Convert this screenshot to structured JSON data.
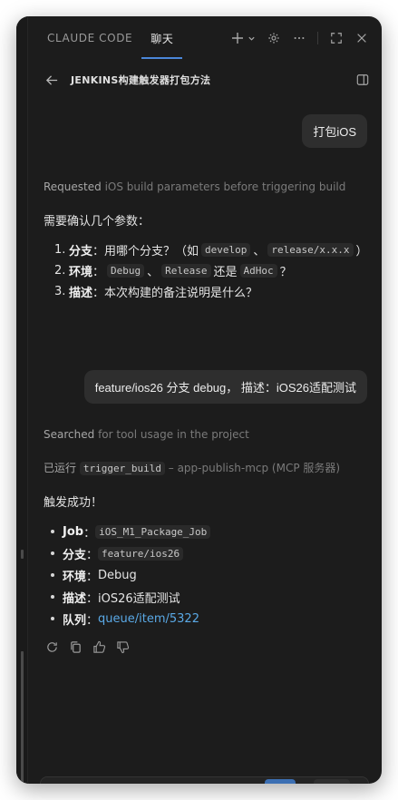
{
  "tabs": [
    {
      "label": "CLAUDE CODE",
      "active": false
    },
    {
      "label": "聊天",
      "active": true
    }
  ],
  "header": {
    "title": "JENKINS构建触发器打包方法"
  },
  "messages": {
    "user1": "打包iOS",
    "meta1": {
      "verb": "Requested",
      "detail": "iOS build parameters before triggering build"
    },
    "intro": "需要确认几个参数：",
    "questions": [
      {
        "num": "1.",
        "label": "分支",
        "colon": "：",
        "text1": "用哪个分支？（如",
        "code1": "develop",
        "sep": "、",
        "code2": "release/x.x.x",
        "text2": "）"
      },
      {
        "num": "2.",
        "label": "环境",
        "colon": "：",
        "code1": "Debug",
        "sep": "、",
        "code2": "Release",
        "text1": "还是",
        "code3": "AdHoc",
        "text2": "？"
      },
      {
        "num": "3.",
        "label": "描述",
        "colon": "：",
        "text1": "本次构建的备注说明是什么？"
      }
    ],
    "user2": "feature/ios26 分支 debug， 描述：iOS26适配测试",
    "meta2": {
      "verb": "Searched",
      "detail": "for tool usage in the project"
    },
    "meta3": {
      "prefix": "已运行",
      "code": "trigger_build",
      "suffix": "– app-publish-mcp (MCP 服务器)"
    },
    "success": "触发成功！",
    "results": [
      {
        "label": "Job",
        "colon": "：",
        "code": "iOS_M1_Package_Job"
      },
      {
        "label": "分支",
        "colon": "：",
        "code": "feature/ios26"
      },
      {
        "label": "环境",
        "colon": "：",
        "text": "Debug"
      },
      {
        "label": "描述",
        "colon": "：",
        "text": "iOS26适配测试"
      },
      {
        "label": "队列",
        "colon": "：",
        "link": "queue/item/5322"
      }
    ]
  },
  "icons": [
    "plus-icon",
    "chevron-down-icon",
    "gear-icon",
    "more-icon",
    "expand-icon",
    "close-icon",
    "arrow-left-icon",
    "panel-icon",
    "retry-icon",
    "copy-icon",
    "thumbs-up-icon",
    "thumbs-down-icon"
  ],
  "colors": {
    "accent": "#4a86d8",
    "link": "#5aa9e6",
    "background": "#1c1c1c",
    "bubble": "#2e2e2e"
  }
}
